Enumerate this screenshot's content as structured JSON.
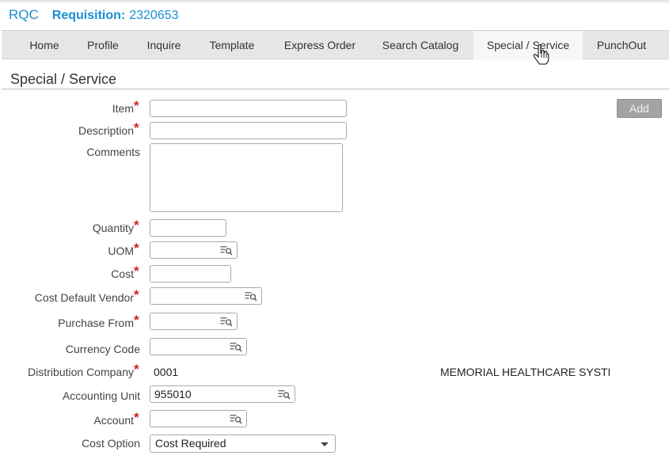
{
  "header": {
    "app_name": "RQC",
    "requisition_label": "Requisition:",
    "requisition_number": "2320653"
  },
  "nav": {
    "tabs": [
      {
        "label": "Home"
      },
      {
        "label": "Profile"
      },
      {
        "label": "Inquire"
      },
      {
        "label": "Template"
      },
      {
        "label": "Express Order"
      },
      {
        "label": "Search Catalog"
      },
      {
        "label": "Special / Service",
        "active": true
      },
      {
        "label": "PunchOut"
      }
    ]
  },
  "page": {
    "title": "Special / Service"
  },
  "form": {
    "item_label": "Item",
    "description_label": "Description",
    "comments_label": "Comments",
    "quantity_label": "Quantity",
    "uom_label": "UOM",
    "cost_label": "Cost",
    "cost_default_vendor_label": "Cost Default Vendor",
    "purchase_from_label": "Purchase From",
    "currency_code_label": "Currency Code",
    "distribution_company_label": "Distribution Company",
    "distribution_company_value": "0001",
    "distribution_company_name": "MEMORIAL HEALTHCARE SYSTE",
    "accounting_unit_label": "Accounting Unit",
    "accounting_unit_value": "955010",
    "account_label": "Account",
    "cost_option_label": "Cost Option",
    "cost_option_value": "Cost Required",
    "required_mark": "*"
  },
  "buttons": {
    "add_label": "Add"
  },
  "colors": {
    "accent": "#1a8fd1",
    "required": "#d42020",
    "nav_bg": "#e6e6e6"
  }
}
